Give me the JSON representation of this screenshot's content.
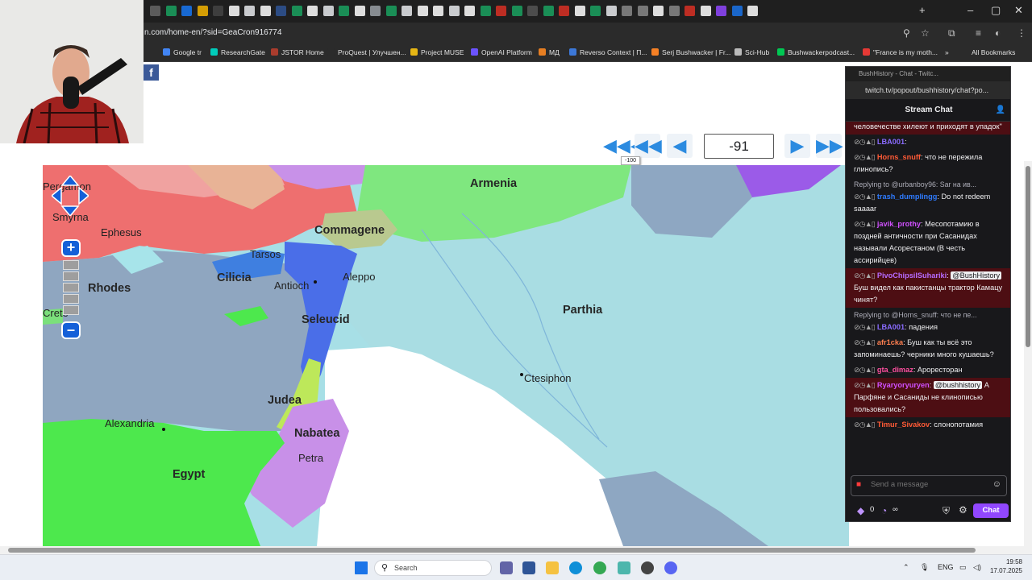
{
  "browser": {
    "url": "n.com/home-en/?sid=GeaCron916774",
    "bookmarks": [
      {
        "label": "Google tr",
        "color": "#4285f4"
      },
      {
        "label": "ResearchGate",
        "color": "#00ccbb"
      },
      {
        "label": "JSTOR Home",
        "color": "#a93c2d"
      },
      {
        "label": "ProQuest | Улучшен...",
        "color": "#2b2b2b"
      },
      {
        "label": "Project MUSE",
        "color": "#e5b514"
      },
      {
        "label": "OpenAI Platform",
        "color": "#6b53ff"
      },
      {
        "label": "МД",
        "color": "#e67e22"
      },
      {
        "label": "Reverso Context | П...",
        "color": "#3c78d8"
      },
      {
        "label": "Serj Bushwacker | Fr...",
        "color": "#f58025"
      },
      {
        "label": "Sci-Hub",
        "color": "#bbb"
      },
      {
        "label": "Bushwackerpodcast...",
        "color": "#00c853"
      },
      {
        "label": "\"France is my moth...",
        "color": "#e53935"
      }
    ],
    "all_bookmarks": "All Bookmarks"
  },
  "map_page": {
    "year": "-91",
    "tooltip": "-100",
    "labels_big": [
      "Armenia",
      "Commagene",
      "Cilicia",
      "Rhodes",
      "Seleucid",
      "Parthia",
      "Judea",
      "Nabatea",
      "Egypt"
    ],
    "labels_small": [
      "Pergamon",
      "Smyrna",
      "Ephesus",
      "Tarsos",
      "Antioch",
      "Aleppo",
      "Ctesiphon",
      "Alexandria",
      "Petra",
      "Crete"
    ]
  },
  "chat": {
    "window_title": "BushHistory - Chat - Twitc...",
    "url": "twitch.tv/popout/bushhistory/chat?po...",
    "header": "Stream Chat",
    "top_fragment": "человечестве хилеют и приходят в упадок\"",
    "messages": [
      {
        "user": "LBA001",
        "text": "",
        "color": "#8a6bff",
        "hl": false
      },
      {
        "user": "Horns_snuff",
        "text": "что не пережила глинопись?",
        "color": "#ff5a36",
        "hl": false
      },
      {
        "reply": "Replying to @urbanboy96: Sar на ив...",
        "user": "trash_dumplingg",
        "text": "Do not redeem saaaar",
        "color": "#2e7bff",
        "hl": false
      },
      {
        "user": "javik_prothy",
        "text": "Месопотамию в поздней античности при Сасанидах называли Асорестаном (В честь ассирийцев)",
        "color": "#d050ff",
        "hl": false
      },
      {
        "user": "PivoChipsiISuhariki",
        "text": "Буш видел как пакистанцы трактор Камацу чинят?",
        "mention": "@BushHistory",
        "color": "#b66bff",
        "hl": true
      },
      {
        "reply": "Replying to @Horns_snuff: что не пе...",
        "user": "LBA001",
        "text": "падения",
        "color": "#8a6bff",
        "hl": false
      },
      {
        "user": "afr1cka",
        "text": "Буш как ты всё это запоминаешь? черники много кушаешь?",
        "color": "#ff7f50",
        "hl": false
      },
      {
        "user": "gta_dimaz",
        "text": "Ароресторан",
        "color": "#ff4fa0",
        "hl": false
      },
      {
        "user": "Ryaryoryuryen",
        "text": "А Парфяне и Сасаниды не клинописью пользовались?",
        "mention": "@bushhistory",
        "color": "#d050ff",
        "hl": true
      },
      {
        "user": "Timur_Sivakov",
        "text": "слонопотамия",
        "color": "#ff5a36",
        "hl": false
      }
    ],
    "input_placeholder": "Send a message",
    "points": "0",
    "infinity": "∞",
    "chat_button": "Chat"
  },
  "taskbar": {
    "search": "Search",
    "lang": "ENG",
    "time": "19:58",
    "date": "17.07.2025"
  }
}
